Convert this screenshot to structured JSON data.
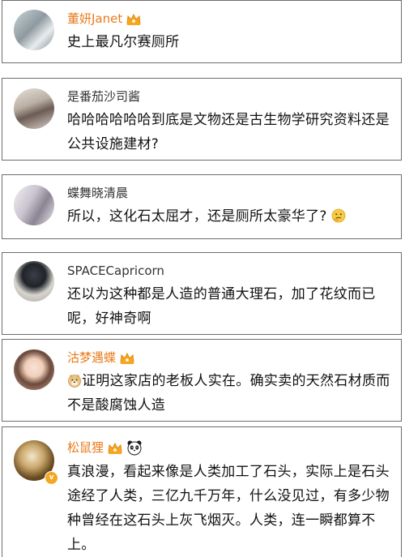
{
  "comments": [
    {
      "username": "董妍Janet",
      "vip": true,
      "badges": [
        "crown-badge-icon"
      ],
      "text": "史上最凡尔赛厕所",
      "prefix_emoji": null,
      "suffix_emoji": null
    },
    {
      "username": "是番茄沙司酱",
      "vip": false,
      "badges": [],
      "text": "哈哈哈哈哈哈到底是文物还是古生物学研究资料还是公共设施建材?",
      "prefix_emoji": null,
      "suffix_emoji": null
    },
    {
      "username": "蝶舞晓清晨",
      "vip": false,
      "badges": [],
      "text": "所以，这化石太屈才，还是厕所太豪华了?",
      "prefix_emoji": null,
      "suffix_emoji": "thinking-face-icon"
    },
    {
      "username": "SPACECapricorn",
      "vip": false,
      "badges": [],
      "text": "还以为这种都是人造的普通大理石，加了花纹而已呢，好神奇啊",
      "prefix_emoji": null,
      "suffix_emoji": null
    },
    {
      "username": "沽梦遇蝶",
      "vip": true,
      "badges": [
        "crown-badge-icon"
      ],
      "text": "证明这家店的老板人实在。确实卖的天然石材质而不是酸腐蚀人造",
      "prefix_emoji": "doge-icon",
      "suffix_emoji": null
    },
    {
      "username": "松鼠狸",
      "vip": true,
      "badges": [
        "crown-badge-icon",
        "panda-badge-icon"
      ],
      "verified": true,
      "text": "真浪漫，看起来像是人类加工了石头，实际上是石头途经了人类，三亿九千万年，什么没见过，有多少物种曾经在这石头上灰飞烟灭。人类，连一瞬都算不上。",
      "prefix_emoji": null,
      "suffix_emoji": null
    }
  ],
  "colors": {
    "vip_name": "#ea7a1a",
    "name": "#333333",
    "text": "#111111",
    "border": "#6d6d6d",
    "crown": "#f5a623"
  }
}
